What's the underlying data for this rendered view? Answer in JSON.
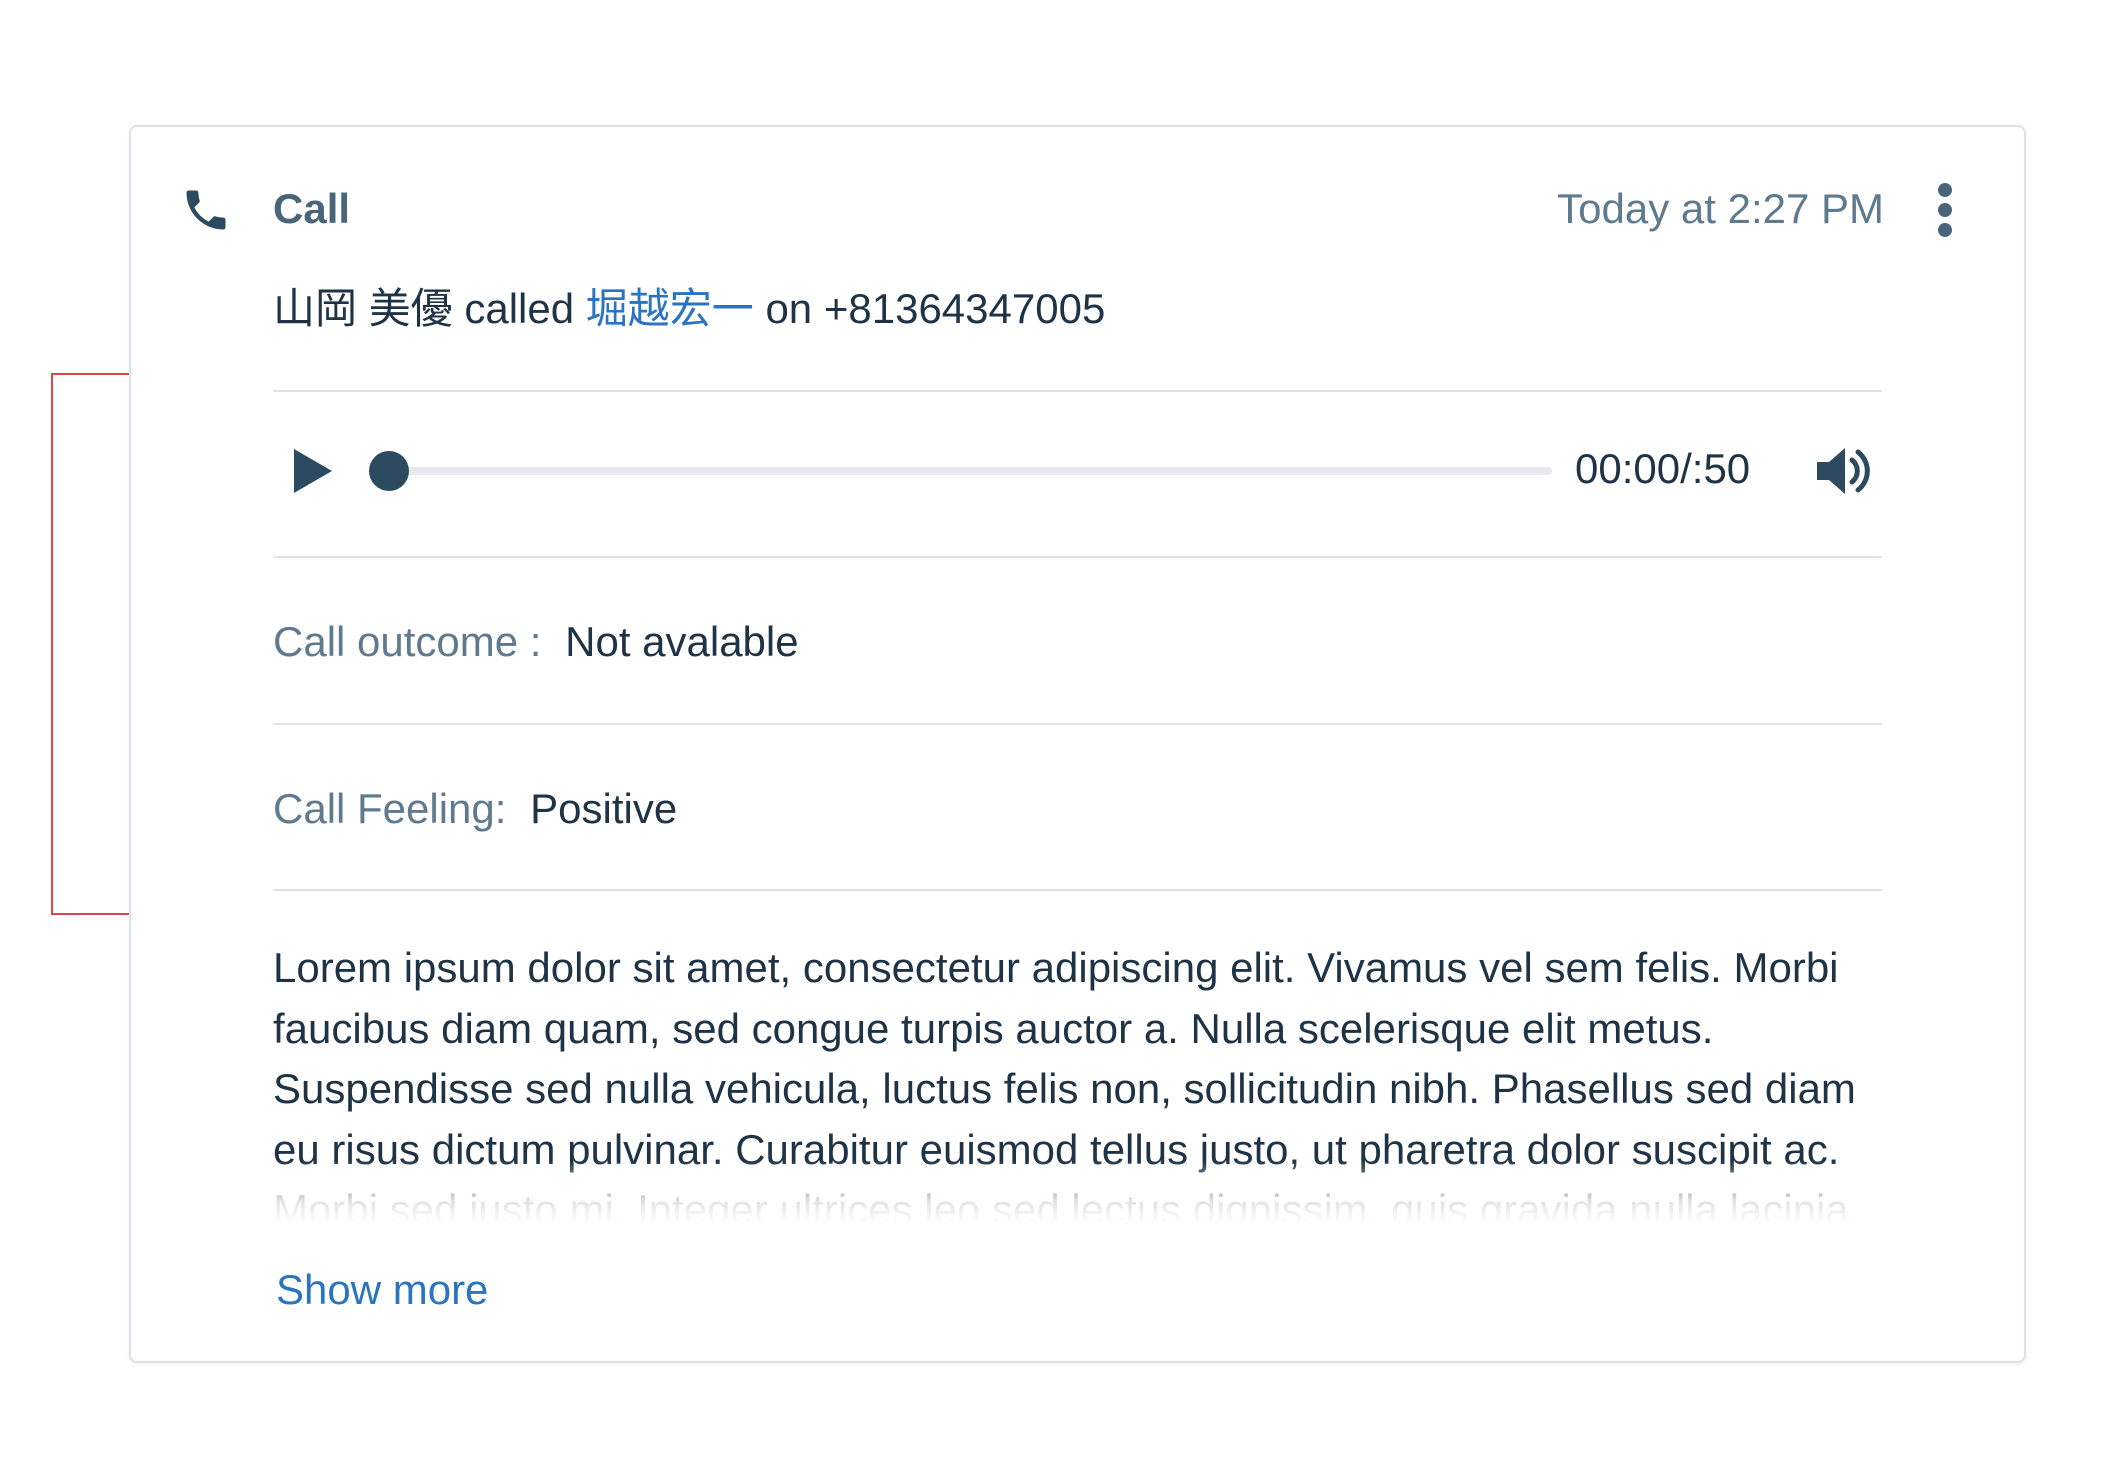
{
  "header": {
    "title": "Call",
    "icon": "phone-icon",
    "timestamp": "Today at 2:27 PM",
    "menu_icon": "more-vertical-icon"
  },
  "summary": {
    "caller": "山岡 美優",
    "verb": "called",
    "callee": "堀越宏一",
    "connector": "on",
    "phone_number": "+81364347005"
  },
  "player": {
    "play_icon": "play-icon",
    "progress": 0,
    "time": "00:00/:50",
    "volume_icon": "volume-icon"
  },
  "fields": [
    {
      "label": "Call outcome :",
      "value": "Not avalable"
    },
    {
      "label": "Call Feeling:",
      "value": "Positive"
    }
  ],
  "notes": {
    "text": "Lorem ipsum dolor sit amet, consectetur adipiscing elit. Vivamus vel sem felis. Morbi faucibus diam quam, sed congue turpis auctor a. Nulla scelerisque elit metus. Suspendisse sed nulla vehicula, luctus felis non, sollicitudin nibh. Phasellus sed diam eu risus dictum pulvinar. Curabitur euismod tellus justo, ut pharetra dolor suscipit ac. Morbi sed justo mi. Integer ultrices leo sed lectus dignissim, quis gravida nulla lacinia.",
    "show_more_label": "Show more"
  },
  "colors": {
    "accent": "#2a74c0",
    "annotation": "#e04848",
    "icon": "#2c4a60"
  }
}
